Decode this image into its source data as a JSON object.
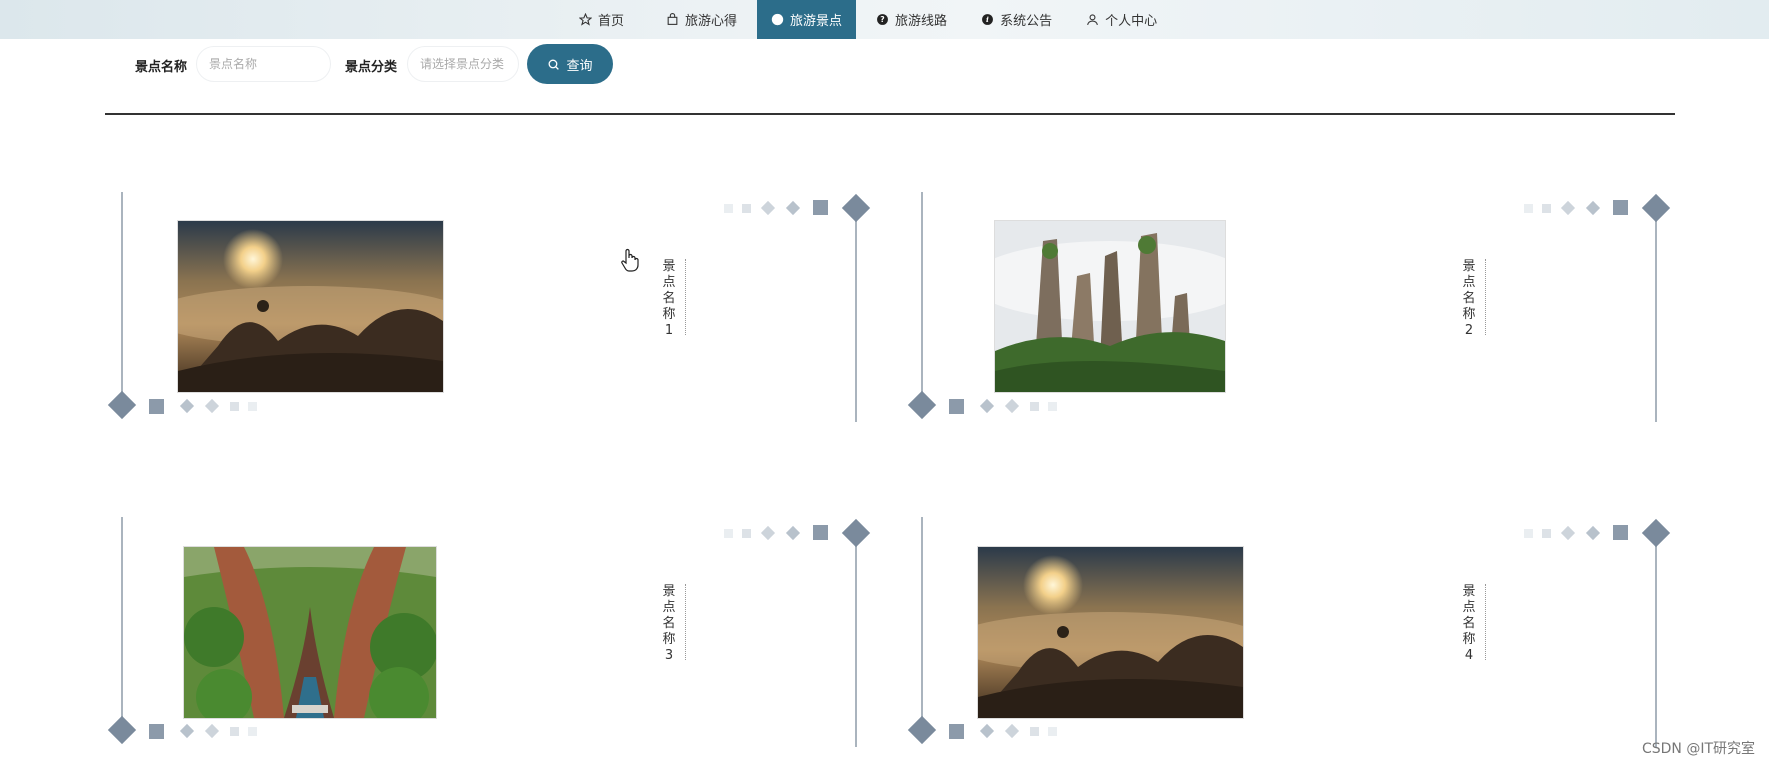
{
  "nav": {
    "items": [
      {
        "label": "首页",
        "icon": "star-icon"
      },
      {
        "label": "旅游心得",
        "icon": "bag-icon"
      },
      {
        "label": "旅游景点",
        "icon": "info-icon",
        "active": true
      },
      {
        "label": "旅游线路",
        "icon": "question-icon"
      },
      {
        "label": "系统公告",
        "icon": "info-italic-icon"
      },
      {
        "label": "个人中心",
        "icon": "user-icon"
      }
    ]
  },
  "search": {
    "name_label": "景点名称",
    "name_placeholder": "景点名称",
    "category_label": "景点分类",
    "category_placeholder": "请选择景点分类",
    "button_label": "查询",
    "button_icon": "search-icon"
  },
  "cards": [
    {
      "name": "景点名称1",
      "image": "sunrise-over-clouds-scene"
    },
    {
      "name": "景点名称2",
      "image": "misty-stone-pillars-scene"
    },
    {
      "name": "景点名称3",
      "image": "green-canyon-river-scene"
    },
    {
      "name": "景点名称4",
      "image": "sunrise-over-clouds-scene"
    }
  ],
  "colors": {
    "accent": "#2c6d8a",
    "decor": "#7a8a9c"
  },
  "watermark": "CSDN @IT研究室"
}
